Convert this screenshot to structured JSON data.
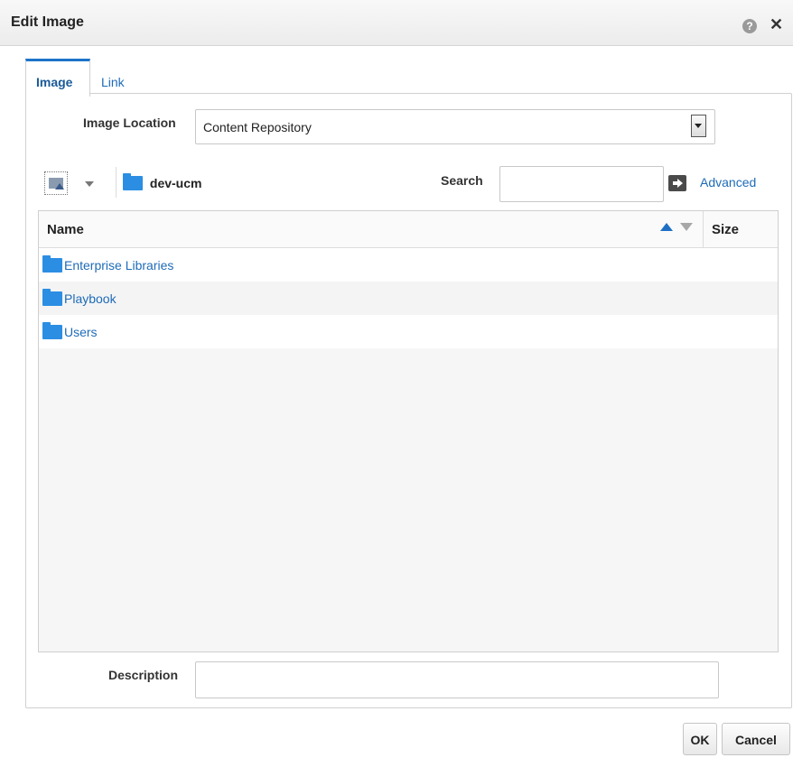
{
  "dialog": {
    "title": "Edit Image"
  },
  "tabs": [
    {
      "label": "Image",
      "selected": true
    },
    {
      "label": "Link",
      "selected": false
    }
  ],
  "image_location": {
    "label": "Image Location",
    "selected_value": "Content Repository"
  },
  "toolbar": {
    "current_folder": "dev-ucm",
    "search_label": "Search",
    "search_value": "",
    "advanced_label": "Advanced"
  },
  "table": {
    "columns": [
      "Name",
      "Size"
    ],
    "sort": {
      "column": "Name",
      "direction": "ascending"
    },
    "rows": [
      {
        "name": "Enterprise Libraries",
        "size": ""
      },
      {
        "name": "Playbook",
        "size": ""
      },
      {
        "name": "Users",
        "size": ""
      }
    ]
  },
  "description": {
    "label": "Description",
    "value": ""
  },
  "buttons": {
    "ok": "OK",
    "cancel": "Cancel"
  },
  "colors": {
    "accent": "#1d74c9",
    "link": "#1e6bb8",
    "folder": "#2b8ee3"
  }
}
